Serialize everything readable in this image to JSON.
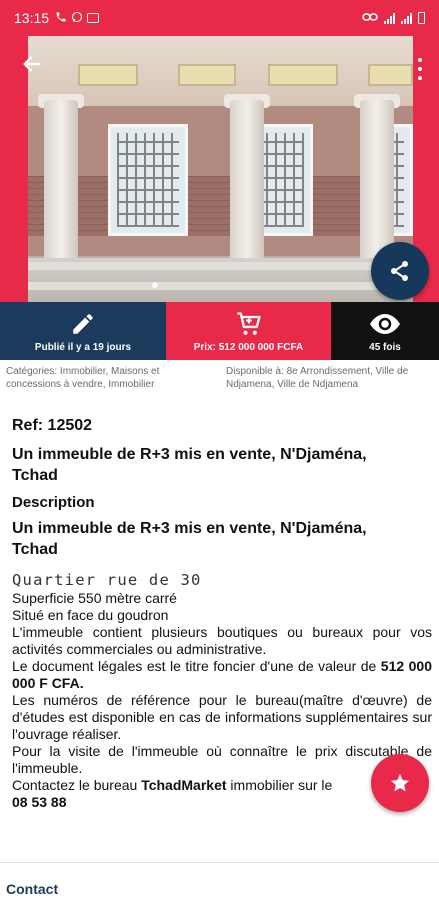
{
  "colors": {
    "brand_red": "#e8294a",
    "navy": "#1c3b5c",
    "dark_fab": "#16385a",
    "black": "#111111"
  },
  "status_bar": {
    "time": "13:15",
    "icons": [
      "phone-icon",
      "whatsapp-icon",
      "mail-icon",
      "link-icon",
      "signal-icon",
      "battery-icon"
    ]
  },
  "gallery": {
    "current_index": 1
  },
  "stats": {
    "published": "Publié il y a 19 jours",
    "price": "Prix: 512 000 000 FCFA",
    "views": "45 fois"
  },
  "meta": {
    "categories": "Catégories: Immobilier, Maisons et concessions à vendre, Immobilier",
    "availability": "Disponible à: 8e Arrondissement, Ville de Ndjamena, Ville de Ndjamena"
  },
  "listing": {
    "ref": "Ref: 12502",
    "title": "Un immeuble de R+3 mis en vente, N'Djaména, Tchad",
    "description_label": "Description",
    "description_title": "Un immeuble de R+3 mis en vente, N'Djaména, Tchad",
    "quartier": "Quartier rue de 30",
    "line1": "Superficie 550 mètre carré",
    "line2": "Situé en face du goudron",
    "para1": "L'immeuble contient plusieurs boutiques ou bureaux pour vos activités commerciales ou administrative.",
    "para2_start": "Le document légales est le titre foncier d'une de valeur de ",
    "para2_value": "512 000 000 F CFA.",
    "para3": "Les numéros de référence pour le bureau(maître d'œuvre) de d'études est disponible en cas de informations supplémentaires sur l'ouvrage réaliser.",
    "para4": "Pour la visite de l'immeuble où connaître le prix discutable de l'immeuble.",
    "para5_start": "Contactez le bureau ",
    "para5_company": "TchadMarket",
    "para5_mid": " immobilier sur le ",
    "para5_phone": "08 53 88"
  },
  "footer": {
    "contact_label": "Contact"
  }
}
